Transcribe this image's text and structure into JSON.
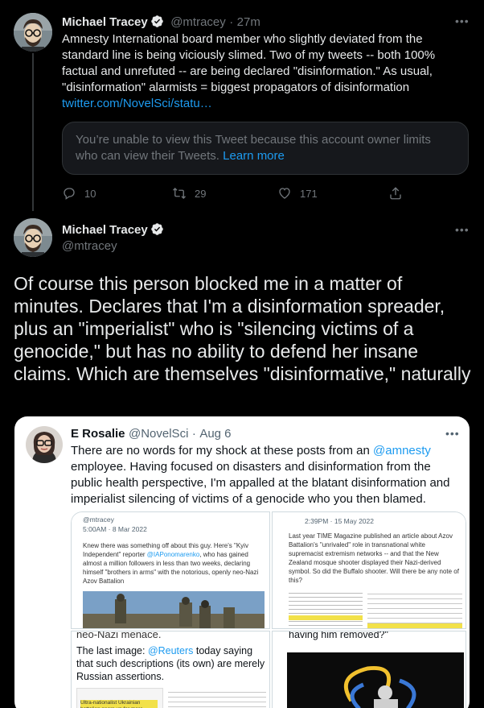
{
  "tweet1": {
    "author": "Michael Tracey",
    "handle": "@mtracey",
    "time": "27m",
    "text": "Amnesty International board member who slightly deviated from the standard line is being viciously slimed. Two of my tweets -- both 100% factual and unrefuted -- are being declared \"disinformation.\" As usual, \"disinformation\" alarmists = biggest propagators of disinformation",
    "link": "twitter.com/NovelSci/statu…",
    "notice": "You’re unable to view this Tweet because this account owner limits who can view their Tweets.",
    "notice_link": "Learn more",
    "replies": "10",
    "retweets": "29",
    "likes": "171"
  },
  "tweet2": {
    "author": "Michael Tracey",
    "handle": "@mtracey",
    "text": "Of course this person blocked me in a matter of minutes. Declares that I'm a disinformation spreader, plus an \"imperialist\" who is \"silencing victims of a genocide,\" but has no ability to defend her insane claims. Which are themselves \"disinformative,\" naturally"
  },
  "quote": {
    "author": "E Rosalie",
    "handle": "@NovelSci",
    "date": "Aug 6",
    "text_before": "There are no words for my shock at these posts from an ",
    "mention": "@amnesty",
    "text_after": " employee. Having focused on disasters and disinformation from the public health perspective, I'm appalled at the blatant disinformation and imperialist silencing of victims of a genocide who you then blamed.",
    "card1": {
      "handle": "@mtracey",
      "date": "5:00AM · 8 Mar 2022",
      "text_a": "Knew there was something off about this guy. Here's \"Kyiv Independent\" reporter ",
      "mention": "@IAPonomarenko",
      "text_b": ", who has gained almost a million followers in less than two weeks, declaring himself \"brothers in arms\" with the notorious, openly neo-Nazi Azov Battalion"
    },
    "card2": {
      "date": "2:39PM · 15 May 2022",
      "text": "Last year TIME Magazine published an article about Azov Battalion's \"unrivaled\" role in transnational white supremacist extremism networks -- and that the New Zealand mosque shooter displayed their Nazi-derived symbol. So did the Buffalo shooter. Will there be any note of this?"
    },
    "card3": {
      "top": "neo-Nazi menace.",
      "text_a": "The last image: ",
      "mention": "@Reuters",
      "text_b": " today saying that such descriptions (its own) are merely Russian assertions.",
      "highlight": "Ultra-nationalist Ukrainian battalion gears up for more fighting"
    },
    "card4": {
      "top": "having him removed?\""
    }
  },
  "colors": {
    "accent": "#1d9bf0",
    "background": "#000000",
    "muted": "#71767b"
  }
}
